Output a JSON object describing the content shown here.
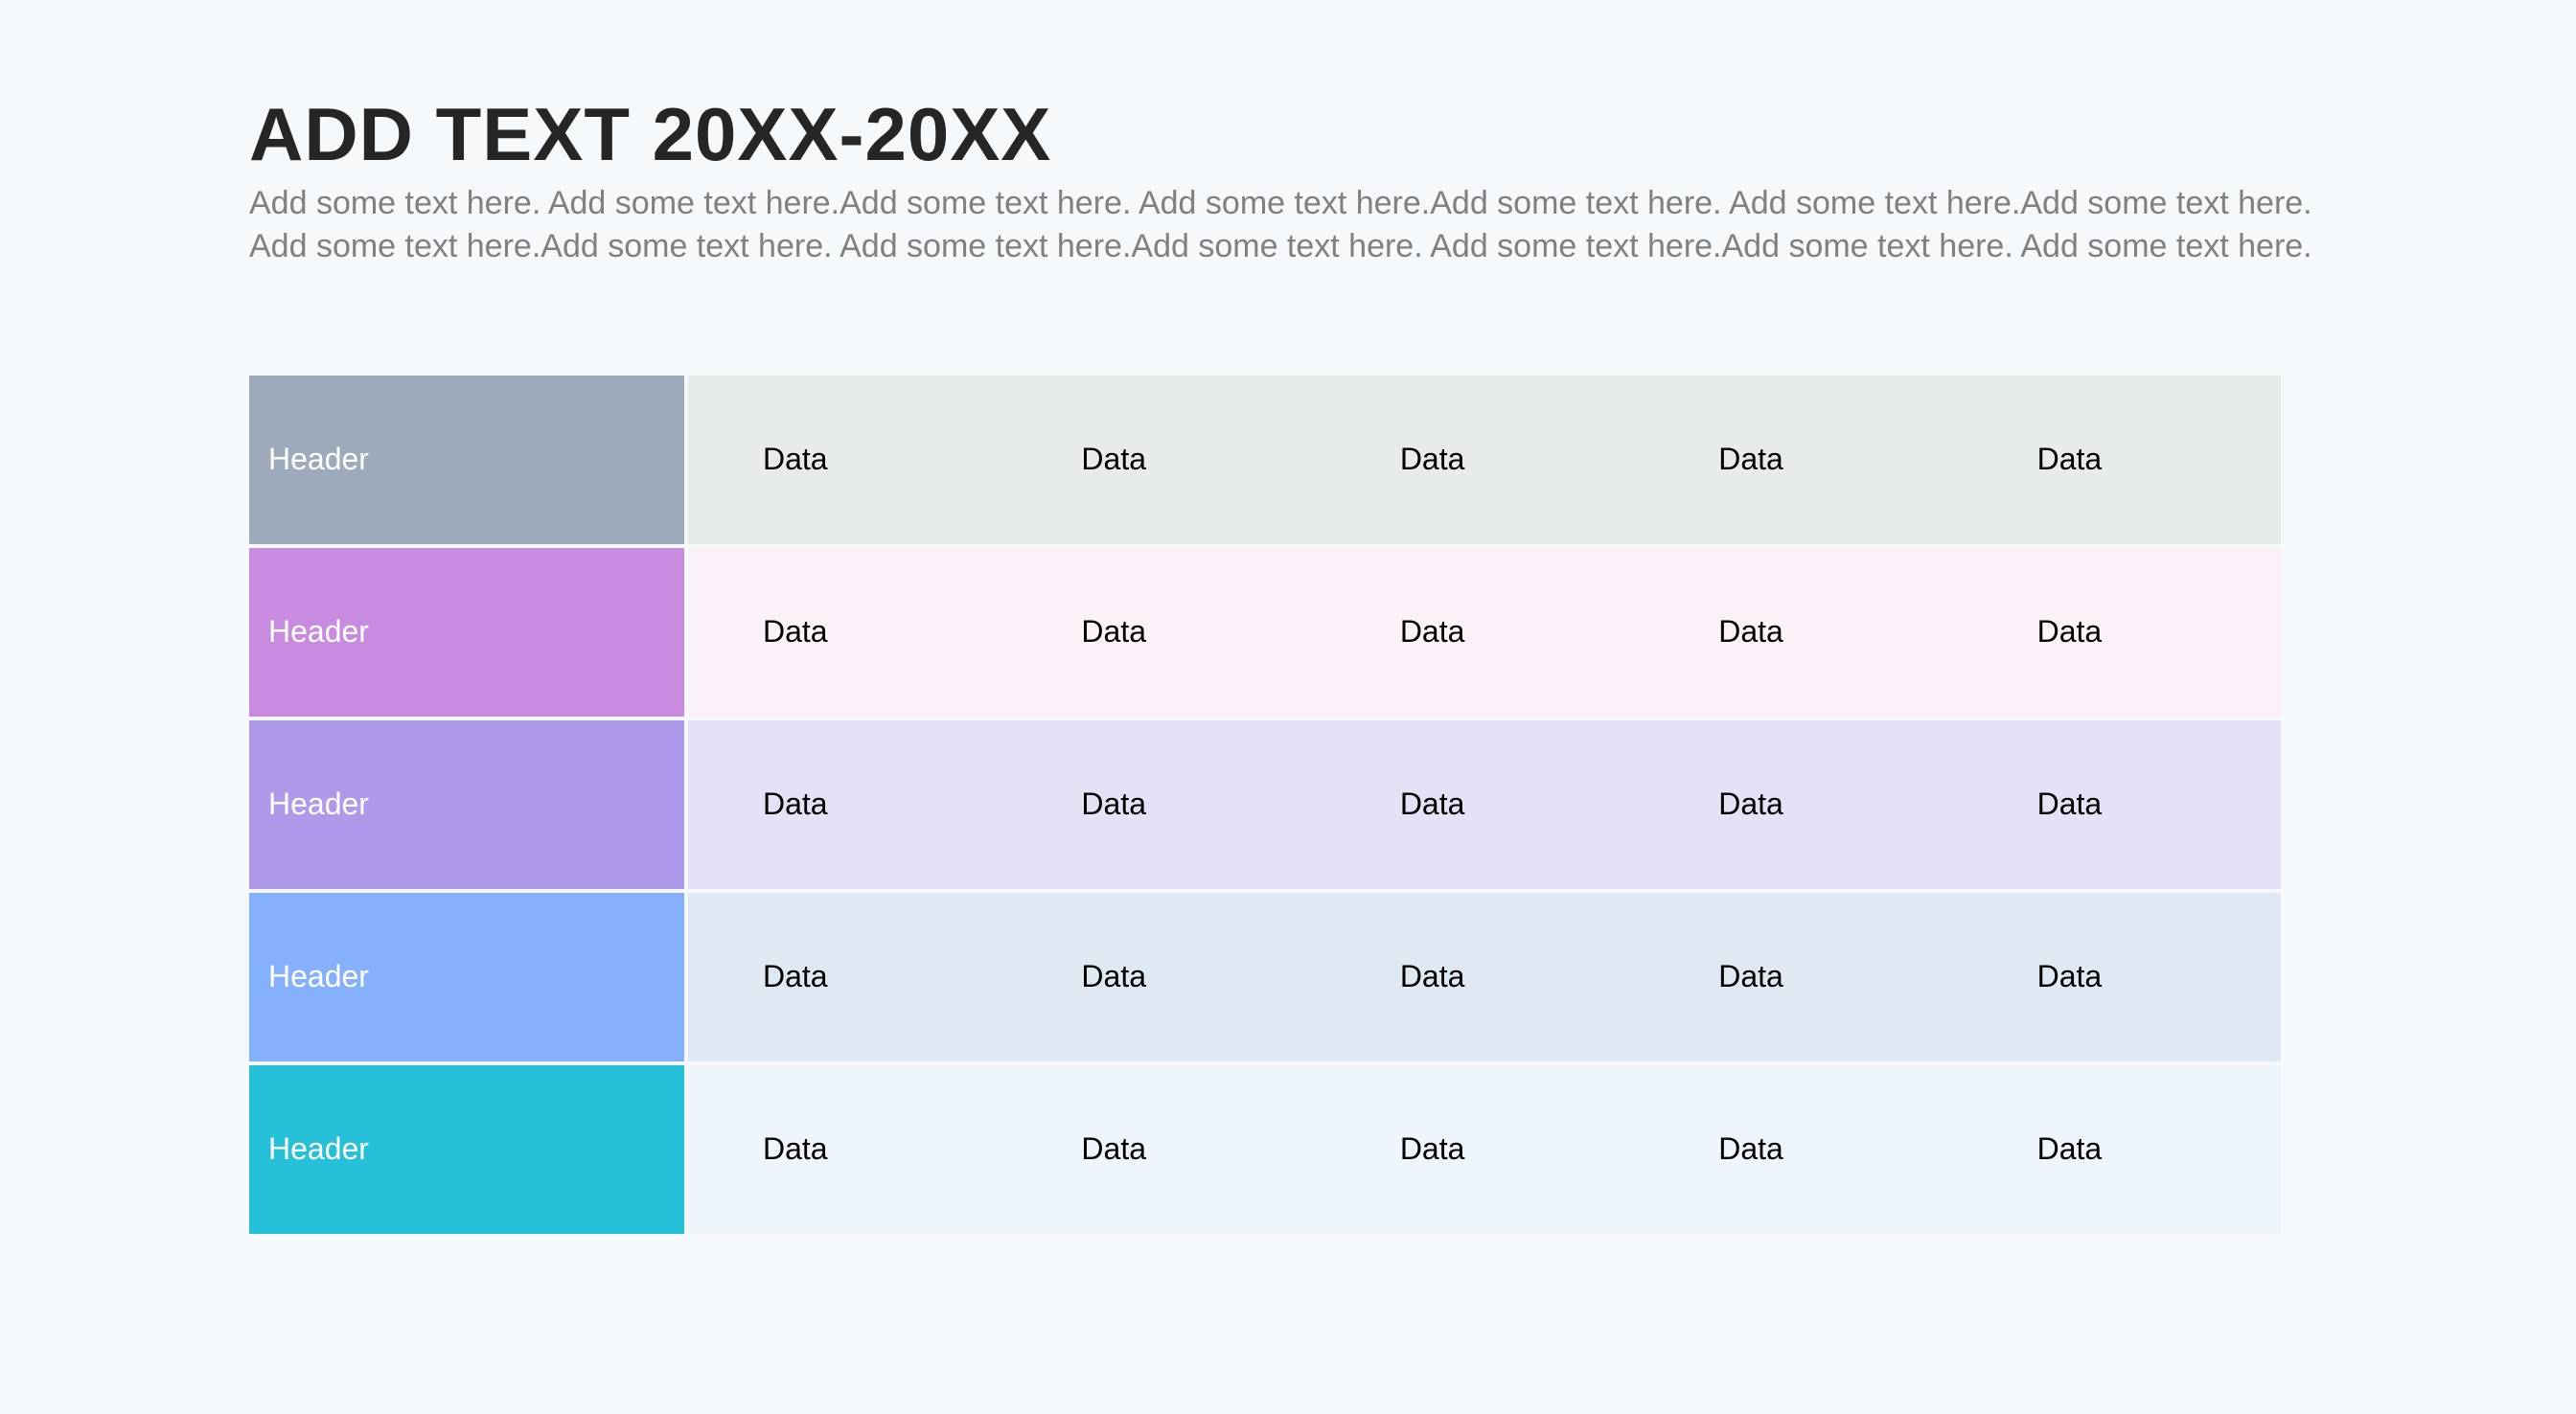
{
  "title": "ADD TEXT 20XX-20XX",
  "subtitle": "Add some text here. Add some text here.Add some text here. Add some text here.Add some text here. Add some text here.Add some text here. Add some text here.Add some text here. Add some text here.Add some text here. Add some text here.Add some text here. Add some text here.",
  "table": {
    "rows": [
      {
        "header": "Header",
        "cells": [
          "Data",
          "Data",
          "Data",
          "Data",
          "Data"
        ]
      },
      {
        "header": "Header",
        "cells": [
          "Data",
          "Data",
          "Data",
          "Data",
          "Data"
        ]
      },
      {
        "header": "Header",
        "cells": [
          "Data",
          "Data",
          "Data",
          "Data",
          "Data"
        ]
      },
      {
        "header": "Header",
        "cells": [
          "Data",
          "Data",
          "Data",
          "Data",
          "Data"
        ]
      },
      {
        "header": "Header",
        "cells": [
          "Data",
          "Data",
          "Data",
          "Data",
          "Data"
        ]
      }
    ]
  },
  "colors": {
    "background": "#f5f9fc",
    "title": "#262626",
    "subtitle": "#808080",
    "rows": [
      {
        "header": "#9dabbc",
        "body": "#e7ebec"
      },
      {
        "header": "#c98be0",
        "body": "#fbf2f9"
      },
      {
        "header": "#af99eb",
        "body": "#e5e1f6"
      },
      {
        "header": "#85b1fc",
        "body": "#dee9f3"
      },
      {
        "header": "#26c0d8",
        "body": "#eef5fb"
      }
    ]
  }
}
